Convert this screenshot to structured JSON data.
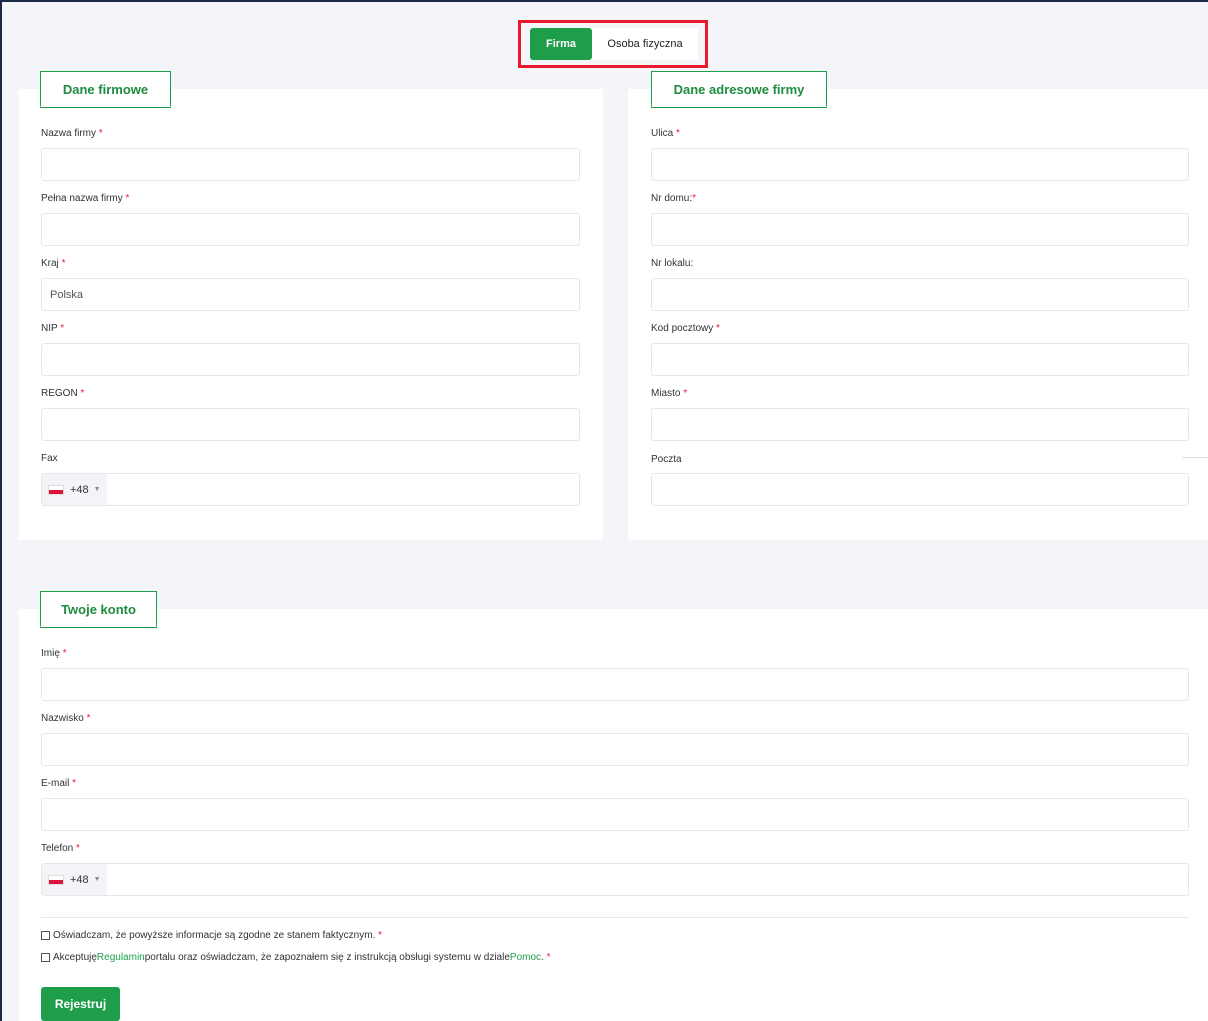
{
  "toggle": {
    "firma": "Firma",
    "osoba": "Osoba fizyczna"
  },
  "company": {
    "title": "Dane firmowe",
    "fields": {
      "nazwa": {
        "label": "Nazwa firmy",
        "req": "*",
        "value": ""
      },
      "pelna": {
        "label": "Pełna nazwa firmy",
        "req": "*",
        "value": ""
      },
      "kraj": {
        "label": "Kraj",
        "req": "*",
        "value": "Polska"
      },
      "nip": {
        "label": "NIP",
        "req": "*",
        "value": ""
      },
      "regon": {
        "label": "REGON",
        "req": "*",
        "value": ""
      },
      "fax": {
        "label": "Fax",
        "code": "+48",
        "value": ""
      }
    }
  },
  "address": {
    "title": "Dane adresowe firmy",
    "fields": {
      "ulica": {
        "label": "Ulica",
        "req": "*",
        "value": ""
      },
      "nr_domu": {
        "label": "Nr domu:",
        "req": "*",
        "value": ""
      },
      "nr_lokalu": {
        "label": "Nr lokalu:",
        "value": ""
      },
      "kod": {
        "label": "Kod pocztowy",
        "req": "*",
        "value": ""
      },
      "miasto": {
        "label": "Miasto",
        "req": "*",
        "value": ""
      },
      "poczta": {
        "label": "Poczta",
        "value": ""
      }
    }
  },
  "account": {
    "title": "Twoje konto",
    "fields": {
      "imie": {
        "label": "Imię",
        "req": "*",
        "value": ""
      },
      "nazwisko": {
        "label": "Nazwisko",
        "req": "*",
        "value": ""
      },
      "email": {
        "label": "E-mail",
        "req": "*",
        "value": ""
      },
      "telefon": {
        "label": "Telefon",
        "req": "*",
        "code": "+48",
        "value": ""
      }
    }
  },
  "consents": {
    "c1": {
      "text": "Oświadczam, że powyższe informacje są zgodne ze stanem faktycznym.",
      "req": "*"
    },
    "c2": {
      "pre": "Akceptuję ",
      "link1": "Regulamin",
      "mid": " portalu oraz oświadczam, że zapoznałem się z instrukcją obsługi systemu w dziale ",
      "link2": "Pomoc",
      "post": ".",
      "req": "*"
    }
  },
  "submit": "Rejestruj",
  "colors": {
    "accent": "#1e9e4b",
    "required": "#e8192c",
    "highlight": "#e8192c"
  }
}
